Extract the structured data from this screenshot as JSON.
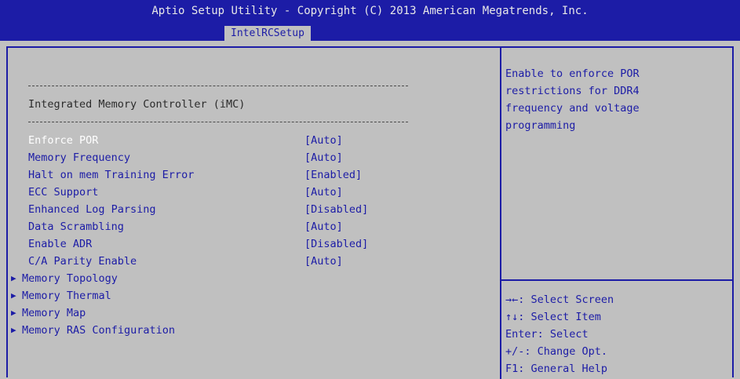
{
  "header": {
    "title": "Aptio Setup Utility - Copyright (C) 2013 American Megatrends, Inc.",
    "tab": "IntelRCSetup"
  },
  "section": {
    "title": "Integrated Memory Controller (iMC)"
  },
  "settings": [
    {
      "label": "Enforce POR",
      "value": "[Auto]"
    },
    {
      "label": "Memory Frequency",
      "value": "[Auto]"
    },
    {
      "label": "Halt on mem Training Error",
      "value": "[Enabled]"
    },
    {
      "label": "ECC Support",
      "value": "[Auto]"
    },
    {
      "label": "Enhanced Log Parsing",
      "value": "[Disabled]"
    },
    {
      "label": "Data Scrambling",
      "value": "[Auto]"
    },
    {
      "label": "Enable ADR",
      "value": "[Disabled]"
    },
    {
      "label": "C/A Parity Enable",
      "value": "[Auto]"
    }
  ],
  "submenus": [
    {
      "label": "Memory Topology"
    },
    {
      "label": "Memory Thermal"
    },
    {
      "label": "Memory Map"
    },
    {
      "label": "Memory RAS Configuration"
    }
  ],
  "help": {
    "lines": [
      "Enable to enforce POR",
      "restrictions for DDR4",
      "frequency and voltage",
      "programming"
    ]
  },
  "keys": [
    "→←: Select Screen",
    "↑↓: Select Item",
    "Enter: Select",
    "+/-: Change Opt.",
    "F1: General Help"
  ],
  "colors": {
    "accent": "#1c1ca6",
    "background": "#c0c0c0",
    "selected": "#ffffff"
  }
}
